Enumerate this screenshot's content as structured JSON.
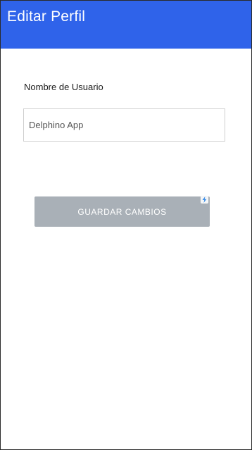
{
  "app_bar": {
    "title": "Editar Perfil",
    "background_color": "#2f63ea"
  },
  "form": {
    "username_label": "Nombre de Usuario",
    "username_value": "Delphino App"
  },
  "actions": {
    "save_label": "GUARDAR CAMBIOS",
    "save_background_color": "#a9b0b7",
    "badge_icon": "lightning-bolt-icon",
    "badge_icon_color": "#3d8fe8"
  }
}
